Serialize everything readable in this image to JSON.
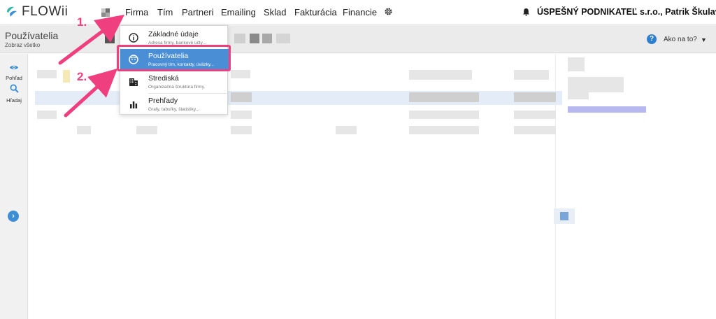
{
  "app": {
    "logo_text": "FLOWii"
  },
  "nav": {
    "items": [
      "Firma",
      "Tím",
      "Partneri",
      "Emailing",
      "Sklad",
      "Fakturácia",
      "Financie"
    ],
    "company": "ÚSPEŠNÝ PODNIKATEĽ s.r.o., Patrik Škulavík"
  },
  "subheader": {
    "title": "Používatelia",
    "subtitle": "Zobraz všetko",
    "help_label": "Ako na to?"
  },
  "rail": {
    "view_label": "Pohľad",
    "search_label": "Hľadaj"
  },
  "dropdown": {
    "items": [
      {
        "title": "Základné údaje",
        "subtitle": "Adresa firmy, bankové účty...",
        "icon": "info-icon",
        "active": false
      },
      {
        "title": "Používatelia",
        "subtitle": "Pracovný tím, kontakty, úväzky...",
        "icon": "face-icon",
        "active": true
      },
      {
        "title": "Strediská",
        "subtitle": "Organizačná štruktúra firmy.",
        "icon": "building-icon",
        "active": false
      },
      {
        "title": "Prehľady",
        "subtitle": "Grafy, tabuľky, štatistiky...",
        "icon": "bar-chart-icon",
        "active": false
      }
    ]
  },
  "annotations": {
    "step1": "1.",
    "step2": "2."
  },
  "colors": {
    "accent": "#ef3f7e",
    "brand_blue": "#4a8fd6",
    "logo_teal": "#2fb6a3"
  }
}
